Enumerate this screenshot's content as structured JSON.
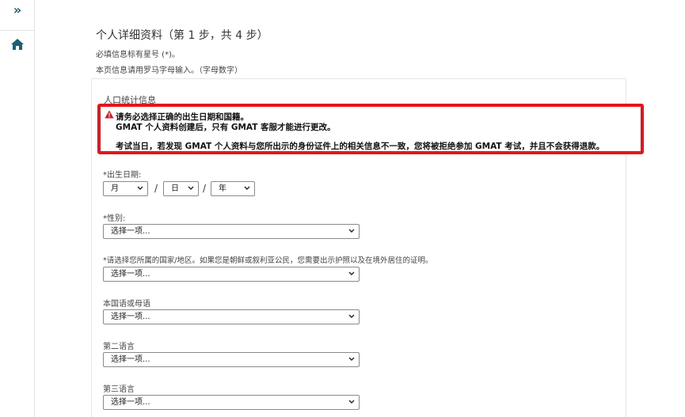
{
  "rail": {
    "expand_icon": "chevrons-right-icon",
    "home_icon": "home-icon"
  },
  "page": {
    "title": "个人详细资料（第 1 步，共 4 步）",
    "required_note": "必填信息标有星号 (*)。",
    "roman_note": "本页信息请用罗马字母输入。（字母数字）",
    "section_title": "人口统计信息"
  },
  "alert": {
    "line1": "请务必选择正确的出生日期和国籍。",
    "line2": "GMAT 个人资料创建后，只有 GMAT 客服才能进行更改。",
    "line3": "考试当日，若发现 GMAT 个人资料与您所出示的身份证件上的相关信息不一致，您将被拒绝参加 GMAT 考试，并且不会获得退款。",
    "icon": "warning-triangle-icon",
    "border_color": "#e8141b"
  },
  "form": {
    "dob": {
      "label": "*出生日期:",
      "month": "月",
      "day": "日",
      "year": "年",
      "separator": "/"
    },
    "gender": {
      "label": "*性别:",
      "value": "选择一项..."
    },
    "country": {
      "label": "*请选择您所属的国家/地区。如果您是朝鲜或叙利亚公民，您需要出示护照以及在境外居住的证明。",
      "value": "选择一项..."
    },
    "native_language": {
      "label": "本国语或母语",
      "value": "选择一项..."
    },
    "second_language": {
      "label": "第二语言",
      "value": "选择一项..."
    },
    "third_language": {
      "label": "第三语言",
      "value": "选择一项..."
    }
  },
  "colors": {
    "accent": "#1a5e7a"
  }
}
